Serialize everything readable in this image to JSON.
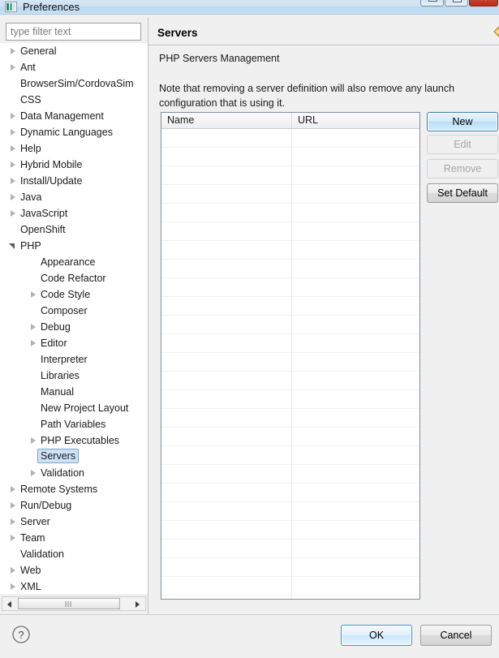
{
  "window": {
    "title": "Preferences",
    "icon": "preferences-icon",
    "controls": {
      "minimize": "minimize-button",
      "maximize": "maximize-button",
      "close_label": "✕"
    }
  },
  "filter": {
    "placeholder": "type filter text",
    "value": ""
  },
  "tree": {
    "items": [
      {
        "label": "General",
        "depth": 0,
        "state": "collapsed"
      },
      {
        "label": "Ant",
        "depth": 0,
        "state": "collapsed"
      },
      {
        "label": "BrowserSim/CordovaSim",
        "depth": 0,
        "state": "leaf"
      },
      {
        "label": "CSS",
        "depth": 0,
        "state": "leaf"
      },
      {
        "label": "Data Management",
        "depth": 0,
        "state": "collapsed"
      },
      {
        "label": "Dynamic Languages",
        "depth": 0,
        "state": "collapsed"
      },
      {
        "label": "Help",
        "depth": 0,
        "state": "collapsed"
      },
      {
        "label": "Hybrid Mobile",
        "depth": 0,
        "state": "collapsed"
      },
      {
        "label": "Install/Update",
        "depth": 0,
        "state": "collapsed"
      },
      {
        "label": "Java",
        "depth": 0,
        "state": "collapsed"
      },
      {
        "label": "JavaScript",
        "depth": 0,
        "state": "collapsed"
      },
      {
        "label": "OpenShift",
        "depth": 0,
        "state": "leaf"
      },
      {
        "label": "PHP",
        "depth": 0,
        "state": "expanded"
      },
      {
        "label": "Appearance",
        "depth": 1,
        "state": "leaf"
      },
      {
        "label": "Code Refactor",
        "depth": 1,
        "state": "leaf"
      },
      {
        "label": "Code Style",
        "depth": 1,
        "state": "collapsed"
      },
      {
        "label": "Composer",
        "depth": 1,
        "state": "leaf"
      },
      {
        "label": "Debug",
        "depth": 1,
        "state": "collapsed"
      },
      {
        "label": "Editor",
        "depth": 1,
        "state": "collapsed"
      },
      {
        "label": "Interpreter",
        "depth": 1,
        "state": "leaf"
      },
      {
        "label": "Libraries",
        "depth": 1,
        "state": "leaf"
      },
      {
        "label": "Manual",
        "depth": 1,
        "state": "leaf"
      },
      {
        "label": "New Project Layout",
        "depth": 1,
        "state": "leaf"
      },
      {
        "label": "Path Variables",
        "depth": 1,
        "state": "leaf"
      },
      {
        "label": "PHP Executables",
        "depth": 1,
        "state": "collapsed"
      },
      {
        "label": "Servers",
        "depth": 1,
        "state": "leaf",
        "selected": true
      },
      {
        "label": "Validation",
        "depth": 1,
        "state": "collapsed"
      },
      {
        "label": "Remote Systems",
        "depth": 0,
        "state": "collapsed"
      },
      {
        "label": "Run/Debug",
        "depth": 0,
        "state": "collapsed"
      },
      {
        "label": "Server",
        "depth": 0,
        "state": "collapsed"
      },
      {
        "label": "Team",
        "depth": 0,
        "state": "collapsed"
      },
      {
        "label": "Validation",
        "depth": 0,
        "state": "leaf"
      },
      {
        "label": "Web",
        "depth": 0,
        "state": "collapsed"
      },
      {
        "label": "XML",
        "depth": 0,
        "state": "collapsed"
      }
    ],
    "scrollbar": {
      "left_arrow": "scroll-left-icon",
      "right_arrow": "scroll-right-icon",
      "thumb": "scroll-thumb"
    }
  },
  "page": {
    "title": "Servers",
    "subtitle": "PHP Servers Management",
    "note": "Note that removing a server definition will also remove any launch configuration that is using it.",
    "nav": {
      "back_icon": "back-arrow-icon",
      "back_menu_icon": "back-history-chevron-icon",
      "forward_icon": "forward-arrow-icon",
      "forward_menu_icon": "forward-history-chevron-icon",
      "menu_icon": "view-menu-chevron-icon",
      "back_color": "#f5d76e",
      "forward_color": "#cfcfcf",
      "menu_color": "#4b1e6b"
    }
  },
  "table": {
    "columns": [
      "Name",
      "URL"
    ],
    "rows": [],
    "empty_row_count": 26
  },
  "side_buttons": [
    {
      "label": "New",
      "state": "primary"
    },
    {
      "label": "Edit",
      "state": "disabled"
    },
    {
      "label": "Remove",
      "state": "disabled"
    },
    {
      "label": "Set Default",
      "state": "normal"
    }
  ],
  "footer": {
    "help_icon": "help-question-icon",
    "ok_label": "OK",
    "cancel_label": "Cancel"
  }
}
